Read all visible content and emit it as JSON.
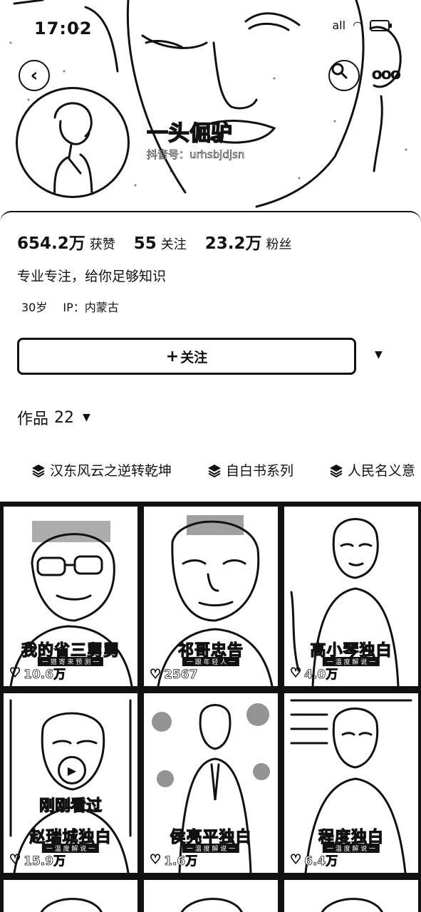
{
  "status_bar": {
    "time": "17:02",
    "signal": "all"
  },
  "profile": {
    "display_name": "一头倔驴",
    "user_id": "抖音号：urhsbjdjsn",
    "stats": [
      {
        "value": "654.2万",
        "label": "获赞"
      },
      {
        "value": "55",
        "label": "关注"
      },
      {
        "value": "23.2万",
        "label": "粉丝"
      }
    ],
    "bio": "专业专注，给你足够知识",
    "age": "30岁",
    "ip": "IP：内蒙古"
  },
  "actions": {
    "follow_label": "关注",
    "dropdown_icon": "caret-down-icon"
  },
  "works": {
    "label": "作品",
    "count": "22"
  },
  "collections": [
    {
      "label": "汉东风云之逆转乾坤"
    },
    {
      "label": "自白书系列"
    },
    {
      "label": "人民名义意"
    }
  ],
  "videos": [
    {
      "title": "我的省三舅舅",
      "subtitle": "一 猎 寄 来 预 测 一",
      "likes": "10.6万"
    },
    {
      "title": "祁哥忠告",
      "subtitle": "一 跟 年 轻 人 一",
      "likes": "2567"
    },
    {
      "title": "高小琴独白",
      "subtitle": "一 温 度 解 说 一",
      "likes": "4.0万"
    },
    {
      "title": "赵瑞城独白",
      "subtitle": "一 温 度 解 说 一",
      "likes": "15.9万",
      "watched_label": "刚刚看过"
    },
    {
      "title": "侯亮平独白",
      "subtitle": "一 温 度 解 说 一",
      "likes": "1.6万"
    },
    {
      "title": "程度独白",
      "subtitle": "一 温 度 解 说 一",
      "likes": "6.4万"
    }
  ]
}
